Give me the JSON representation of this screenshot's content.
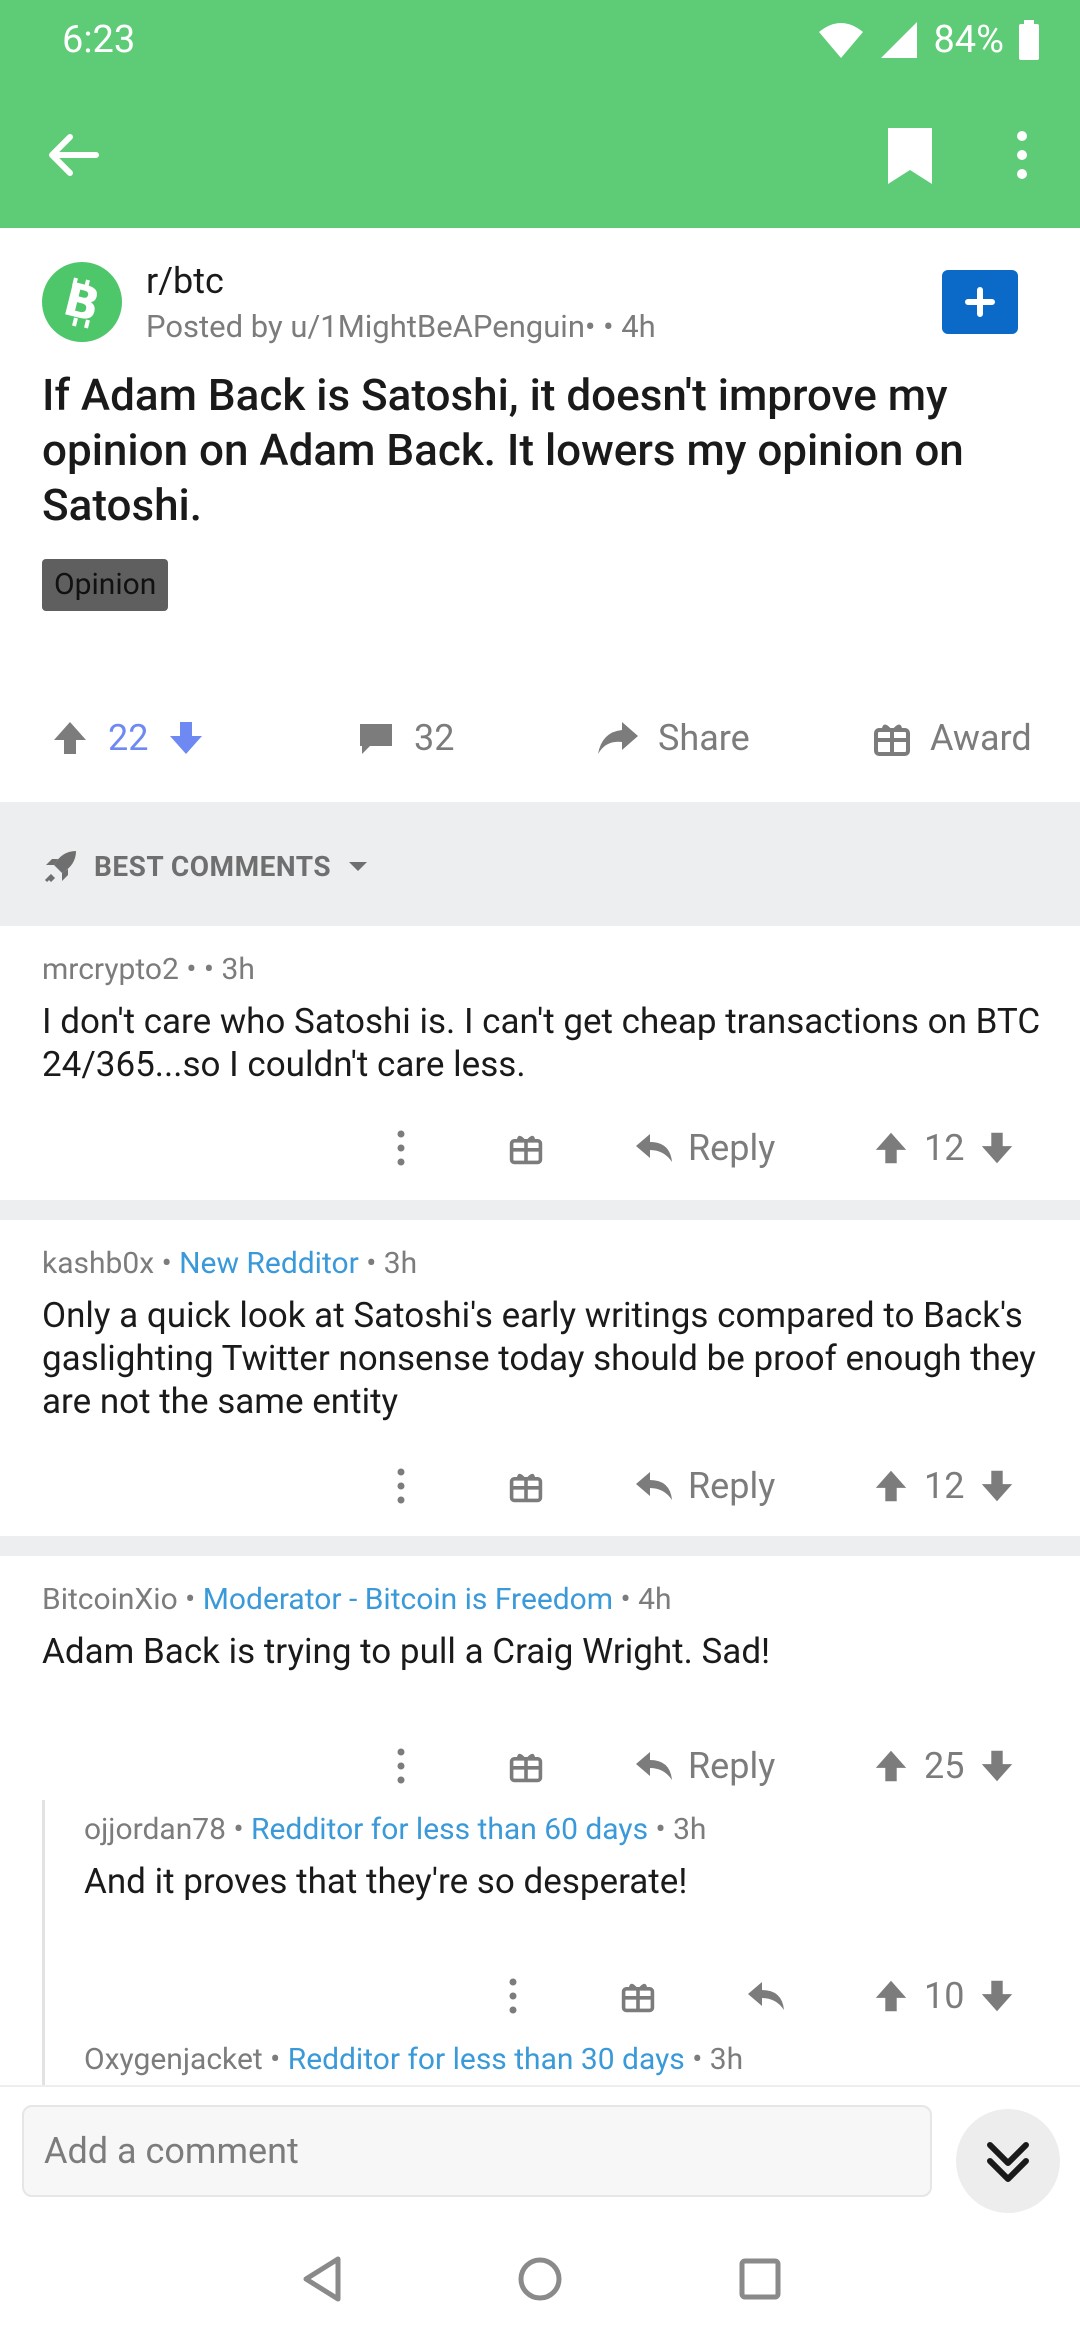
{
  "status_bar": {
    "time": "6:23",
    "battery": "84%"
  },
  "post": {
    "subreddit": "r/btc",
    "posted_by": "Posted by u/1MightBeAPenguin• • 4h",
    "title": "If Adam Back is Satoshi, it doesn't improve my opinion on Adam Back. It lowers my opinion on Satoshi.",
    "flair": "Opinion",
    "votes": "22",
    "comments": "32",
    "share_label": "Share",
    "award_label": "Award"
  },
  "sort": {
    "label": "BEST COMMENTS"
  },
  "comments": [
    {
      "author": "mrcrypto2",
      "separator": " • ",
      "badge": "",
      "time": " • 3h",
      "body": "I don't care who Satoshi is.  I can't get cheap transactions on BTC 24/365...so I couldn't care less.",
      "reply_label": "Reply",
      "score": "12"
    },
    {
      "author": "kashb0x",
      "separator": " • ",
      "badge": "New Redditor",
      "time": " • 3h",
      "body": "Only a quick look at Satoshi's early writings compared to Back's gaslighting Twitter nonsense today should be proof enough they are not the same entity",
      "reply_label": "Reply",
      "score": "12"
    },
    {
      "author": "BitcoinXio",
      "separator": " • ",
      "badge": "Moderator - Bitcoin is Freedom",
      "time": " • 4h",
      "body": "Adam Back is trying to pull a Craig Wright. Sad!",
      "reply_label": "Reply",
      "score": "25"
    },
    {
      "author": "ojjordan78",
      "separator": " • ",
      "badge": "Redditor for less than 60 days",
      "time": " • 3h",
      "body": "And it proves that they're so desperate!",
      "score": "10"
    },
    {
      "author": "Oxygenjacket",
      "separator": " • ",
      "badge": "Redditor for less than 30 days",
      "time": " • 3h"
    }
  ],
  "composer": {
    "placeholder": "Add a comment"
  },
  "colors": {
    "app_bar": "#5ecb77",
    "upvote_active": "#6f89f2",
    "badge": "#3a9ad9",
    "join": "#0b6ac7"
  }
}
